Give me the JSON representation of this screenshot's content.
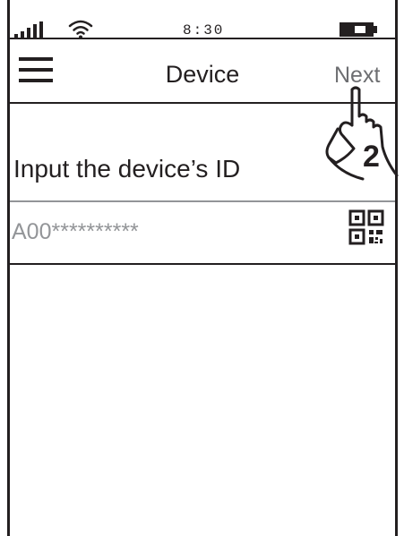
{
  "status_bar": {
    "time": "8:30",
    "icons": [
      "signal-icon",
      "wifi-icon",
      "battery-icon"
    ]
  },
  "header": {
    "menu_icon": "menu-icon",
    "title": "Device",
    "next_label": "Next"
  },
  "step_marker": {
    "number": "2",
    "icon": "pointing-hand-icon"
  },
  "form": {
    "label": "Input the device’s ID",
    "placeholder": "A00**********",
    "scan_icon": "qr-code-icon"
  },
  "colors": {
    "ink": "#231f20",
    "muted": "#6d6e71",
    "placeholder": "#939598"
  }
}
